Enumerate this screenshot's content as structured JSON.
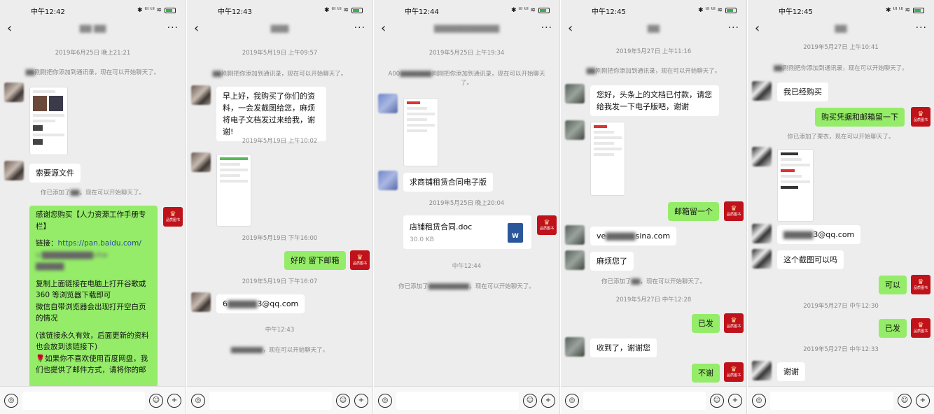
{
  "shared": {
    "more_label": "···",
    "back_label": "‹",
    "file_ext_label": "W",
    "brand_small_text": "品质图书"
  },
  "panels": [
    {
      "status_time": "中午12:42",
      "status_icons": "✱ ᵗˡˡ ᵗˡˡ ≋",
      "title": "▇▇ ▇▇",
      "ts1": "2019年6月25日 晚上21:21",
      "sys1_blur": "▇▇",
      "sys1": "刚刚把你添加到通讯录，现在可以开始聊天了。",
      "msg_source_file": "索要源文件",
      "sys2_pre": "你已添加了",
      "sys2_blur": "▇▇",
      "sys2_post": "，现在可以开始聊天了。",
      "long_msg": {
        "line1": "感谢您购买【人力资源工作手册专栏】",
        "link_label": "链接：",
        "link_url": "https://pan.baidu.com/",
        "link_blur1": "s/▇▇▇▇▇▇▇▇▇sltw",
        "link_blur2": "▇▇▇▇▇",
        "para2": "复制上面链接在电脑上打开谷歌或360 等浏览器下载即可",
        "para3": "微信自带浏览器会出现打开空白页的情况",
        "para4": "(该链接永久有效，后面更新的资料也会放到该链接下)",
        "para5": "🌹如果你不喜欢使用百度网盘，我们也提供了邮件方式，请将你的邮"
      }
    },
    {
      "status_time": "中午12:43",
      "status_icons": "✱ ᵗˡˡ ᵗˡˡ ≋",
      "title": "▇▇▇",
      "ts1": "2019年5月19日 上午09:57",
      "sys1_blur": "▇▇",
      "sys1": "刚刚把你添加到通讯录，现在可以开始聊天了。",
      "msg_bought": "早上好，我购买了你们的资料，一会发截图给您，麻烦将电子文档发过来给我，谢谢!",
      "ts2": "2019年5月19日 上午10:02",
      "ts3": "2019年5月19日 下午16:00",
      "msg_leave_email": "好的 留下邮箱",
      "ts4": "2019年5月19日 下午16:07",
      "email_pre": "6",
      "email_blur": "▇▇▇▇▇",
      "email_post": "3@qq.com",
      "ts5": "中午12:43",
      "sys2_blur": "▇▇▇▇▇▇▇",
      "sys2": "，现在可以开始聊天了。"
    },
    {
      "status_time": "中午12:44",
      "status_icons": "✱ ᵗˡˡ ᵗˡˡ ≋",
      "title": "▇▇▇▇▇▇▇▇▇▇▇",
      "ts1": "2019年5月25日 上午19:34",
      "sys1_pre": "A00",
      "sys1_blur": "▇▇▇▇▇▇▇",
      "sys1": "刚刚把你添加到通讯录，现在可以开始聊天了。",
      "msg_request": "求商铺租赁合同电子版",
      "ts2": "2019年5月25日 晚上20:04",
      "file_name": "店铺租赁合同.doc",
      "file_size": "30.0 KB",
      "ts3": "中午12:44",
      "sys2_pre": "你已添加了",
      "sys2_blur": "▇▇▇▇▇▇▇▇▇",
      "sys2": "，现在可以开始聊天了。"
    },
    {
      "status_time": "中午12:45",
      "status_icons": "✱ ᵗˡˡ ᵗˡˡ ≋",
      "title": "▇▇",
      "ts1": "2019年5月27日 上午11:16",
      "sys1_blur": "▇▇",
      "sys1": "刚刚把你添加到通讯录，现在可以开始聊天了。",
      "msg_paid": "您好，头条上的文档已付款，请您给我发一下电子版吧，谢谢",
      "msg_leave_email": "邮箱留一个",
      "email_pre": "ve",
      "email_blur": "▇▇▇▇▇",
      "email_post": "sina.com",
      "msg_thanks_trouble": "麻烦您了",
      "sys2_pre": "你已添加了",
      "sys2_blur": "▇▇",
      "sys2_post": "，现在可以开始聊天了。",
      "ts2": "2019年5月27日 中午12:28",
      "msg_sent": "已发",
      "msg_received": "收到了，谢谢您",
      "msg_no_thanks": "不谢"
    },
    {
      "status_time": "中午12:45",
      "status_icons": "✱ ᵗˡˡ ᵗˡˡ ≋",
      "title": "▇▇",
      "ts1": "2019年5月27日 上午10:41",
      "sys1_blur": "▇▇",
      "sys1": "刚刚把你添加到通讯录，现在可以开始聊天了。",
      "msg_bought": "我已经购买",
      "msg_proof": "购买凭据和邮箱留一下",
      "sys2_pre": "你已添加了",
      "sys2_mid": "栗衣",
      "sys2_post": "，现在可以开始聊天了。",
      "email_blur": "▇▇▇▇▇",
      "email_post": "3@qq.com",
      "msg_screenshot_ok": "这个截图可以吗",
      "msg_ok": "可以",
      "ts2": "2019年5月27日 中午12:30",
      "msg_sent": "已发",
      "ts3": "2019年5月27日 中午12:33",
      "msg_thanks": "谢谢"
    }
  ]
}
